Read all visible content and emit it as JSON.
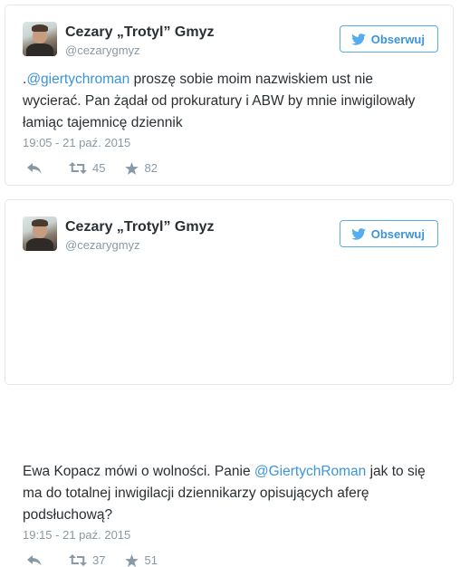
{
  "colors": {
    "link": "#3b94d9",
    "follow_border": "#55acee",
    "muted": "#8899a6",
    "text": "#292f33",
    "card_border": "#e1e8ed"
  },
  "follow_icon": "twitter-bird-icon",
  "tweets": [
    {
      "author_name": "Cezary „Trotyl” Gmyz",
      "handle": "@cezarygmyz",
      "follow_label": "Obserwuj",
      "text_prefix": ".",
      "mention": "@giertychroman",
      "text_after_mention": " proszę sobie moim nazwiskiem ust nie wycierać. Pan żądał od prokuratury i ABW by mnie inwigilowały łamiąc tajemnicę dziennik",
      "timestamp": "19:05 - 21 paź. 2015",
      "retweets": "45",
      "likes": "82"
    },
    {
      "author_name": "Cezary „Trotyl” Gmyz",
      "handle": "@cezarygmyz",
      "follow_label": "Obserwuj",
      "text_prefix": "Ewa Kopacz mówi o wolności. Panie ",
      "mention": "@GiertychRoman",
      "text_after_mention": " jak to się ma do totalnej inwigilacji dziennikarzy opisujących aferę podsłuchową?",
      "timestamp": "19:15 - 21 paź. 2015",
      "retweets": "37",
      "likes": "51"
    }
  ]
}
